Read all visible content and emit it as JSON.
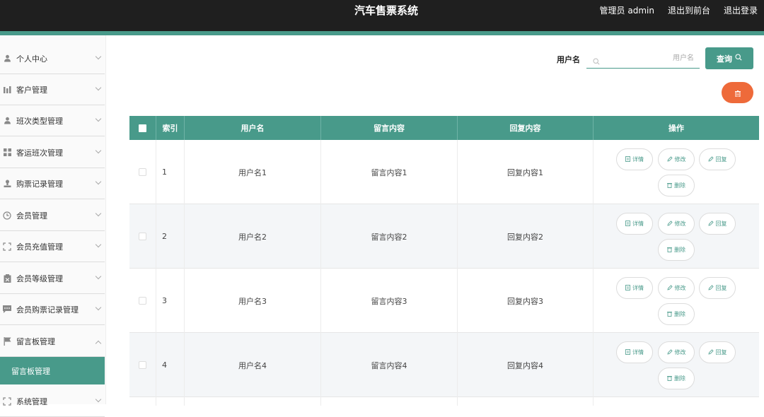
{
  "header": {
    "title": "汽车售票系统",
    "admin_label": "管理员 admin",
    "front_link": "退出到前台",
    "logout_link": "退出登录"
  },
  "sidebar": {
    "items": [
      {
        "label": "个人中心",
        "icon": "user-icon"
      },
      {
        "label": "客户管理",
        "icon": "chart-icon"
      },
      {
        "label": "班次类型管理",
        "icon": "user-icon"
      },
      {
        "label": "客运班次管理",
        "icon": "grid-icon"
      },
      {
        "label": "购票记录管理",
        "icon": "stamp-icon"
      },
      {
        "label": "会员管理",
        "icon": "clock-icon"
      },
      {
        "label": "会员充值管理",
        "icon": "frame-icon"
      },
      {
        "label": "会员等级管理",
        "icon": "clipboard-icon"
      },
      {
        "label": "会员购票记录管理",
        "icon": "chat-icon"
      },
      {
        "label": "留言板管理",
        "icon": "flag-icon"
      }
    ],
    "active_sub": "留言板管理",
    "last_item": {
      "label": "系统管理",
      "icon": "frame-icon"
    }
  },
  "search": {
    "label": "用户名",
    "placeholder": "用户名",
    "value": "",
    "button_label": "查询"
  },
  "table": {
    "headers": [
      "索引",
      "用户名",
      "留言内容",
      "回复内容",
      "操作"
    ],
    "rows": [
      {
        "index": "1",
        "username": "用户名1",
        "message": "留言内容1",
        "reply": "回复内容1"
      },
      {
        "index": "2",
        "username": "用户名2",
        "message": "留言内容2",
        "reply": "回复内容2"
      },
      {
        "index": "3",
        "username": "用户名3",
        "message": "留言内容3",
        "reply": "回复内容3"
      },
      {
        "index": "4",
        "username": "用户名4",
        "message": "留言内容4",
        "reply": "回复内容4"
      }
    ],
    "actions": {
      "detail": "详情",
      "edit": "修改",
      "reply": "回复",
      "delete": "删除"
    }
  },
  "colors": {
    "accent": "#489a8a",
    "topbar": "#1f1f1f",
    "danger": "#ee6a3a"
  }
}
